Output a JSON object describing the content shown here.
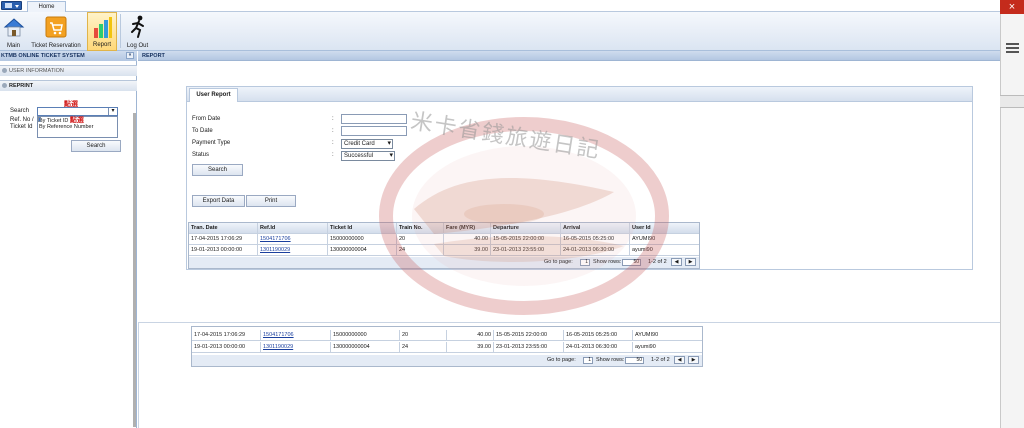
{
  "ribbon": {
    "home_tab": "Home",
    "buttons": [
      {
        "label": "Main",
        "icon": "home-icon"
      },
      {
        "label": "Ticket Reservation",
        "icon": "cart-icon"
      },
      {
        "label": "Report",
        "icon": "bar-chart-icon"
      },
      {
        "label": "Log Out",
        "icon": "running-man-icon"
      }
    ]
  },
  "window": {
    "close": "×",
    "menu_icon": "hamburger-icon"
  },
  "sidebar": {
    "title": "KTMB ONLINE TICKET SYSTEM",
    "collapse": "«",
    "sections": [
      "USER INFORMATION",
      "REPRINT"
    ],
    "search_label": "Search",
    "ref_label": "Ref. No /",
    "ticket_label": "Ticket Id",
    "options": [
      "By Ticket ID",
      "By Reference Number"
    ],
    "annotation": "點選",
    "search_button": "Search"
  },
  "main": {
    "header": "REPORT",
    "tab": "User Report",
    "fields": {
      "from_date": "From Date",
      "to_date": "To Date",
      "payment_type": "Payment Type",
      "status": "Status",
      "colon": ":"
    },
    "payment_value": "Credit Card",
    "status_value": "Successful",
    "search_button": "Search",
    "export_button": "Export Data",
    "print_button": "Print"
  },
  "table": {
    "columns": [
      "Tran. Date",
      "Ref.Id",
      "Ticket Id",
      "Train No.",
      "Fare (MYR)",
      "Departure",
      "Arrival",
      "User Id"
    ],
    "rows": [
      [
        "17-04-2015 17:06:29",
        "1504171706",
        "15000000000",
        "20",
        "40.00",
        "15-05-2015 22:00:00",
        "16-05-2015 05:25:00",
        "AYUMI90"
      ],
      [
        "19-01-2013 00:00:00",
        "1301190029",
        "130000000004",
        "24",
        "39.00",
        "23-01-2013 23:55:00",
        "24-01-2013 06:30:00",
        "ayumi90"
      ]
    ],
    "pager": {
      "go_to": "Go to page:",
      "page": "1",
      "show_rows": "Show rows:",
      "rows": "50",
      "range": "1-2 of 2",
      "prev": "◀",
      "next": "▶"
    }
  },
  "watermark": {
    "text": "米卡省錢旅遊日記"
  }
}
